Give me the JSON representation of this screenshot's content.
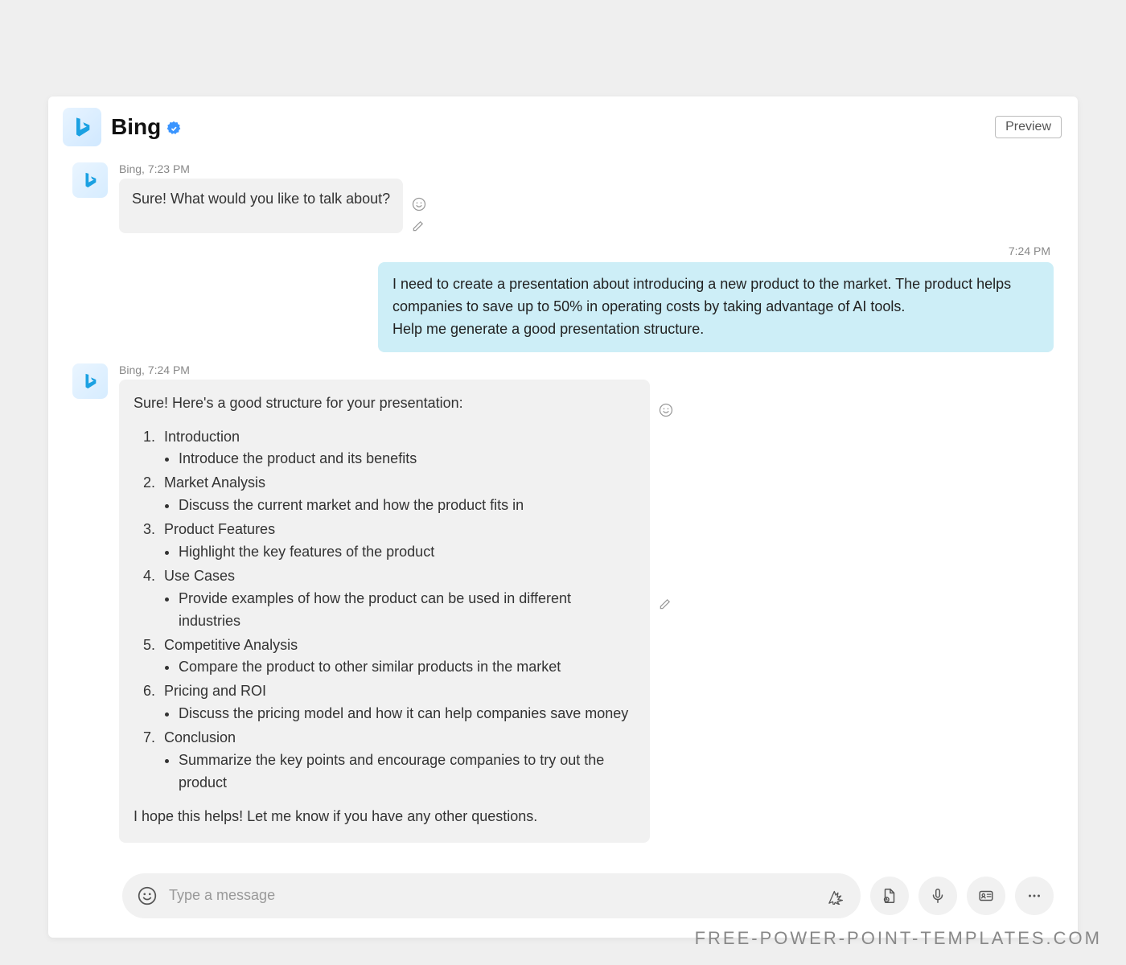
{
  "header": {
    "title": "Bing",
    "preview_label": "Preview"
  },
  "messages": [
    {
      "sender": "Bing",
      "time": "7:23 PM",
      "text": "Sure! What would you like to talk about?"
    },
    {
      "sender": "user",
      "time": "7:24 PM",
      "text": "I need to create a presentation about introducing a new product to the market. The product helps companies to save up to 50% in operating costs by taking advantage of AI tools.\nHelp me generate a good presentation structure."
    },
    {
      "sender": "Bing",
      "time": "7:24 PM",
      "intro": "Sure! Here's a good structure for your presentation:",
      "outro": "I hope this helps! Let me know if you have any other questions.",
      "items": [
        {
          "title": "Introduction",
          "detail": "Introduce the product and its benefits"
        },
        {
          "title": "Market Analysis",
          "detail": "Discuss the current market and how the product fits in"
        },
        {
          "title": "Product Features",
          "detail": "Highlight the key features of the product"
        },
        {
          "title": "Use Cases",
          "detail": "Provide examples of how the product can be used in different industries"
        },
        {
          "title": "Competitive Analysis",
          "detail": "Compare the product to other similar products in the market"
        },
        {
          "title": "Pricing and ROI",
          "detail": "Discuss the pricing model and how it can help companies save money"
        },
        {
          "title": "Conclusion",
          "detail": "Summarize the key points and encourage companies to try out the product"
        }
      ]
    }
  ],
  "compose": {
    "placeholder": "Type a message"
  },
  "watermark": "FREE-POWER-POINT-TEMPLATES.COM"
}
